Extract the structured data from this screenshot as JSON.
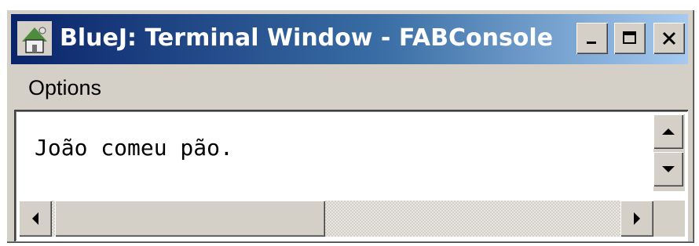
{
  "window": {
    "title": "BlueJ:  Terminal Window - FABConsole",
    "app_icon": "bluej-icon",
    "controls": {
      "minimize_icon": "minimize-icon",
      "maximize_icon": "maximize-icon",
      "close_icon": "close-icon"
    }
  },
  "menubar": {
    "items": [
      {
        "label": "Options"
      }
    ]
  },
  "terminal": {
    "output": "João comeu pão."
  },
  "colors": {
    "titlebar_start": "#0a246a",
    "titlebar_end": "#a6caf0",
    "window_face": "#d4d0c8",
    "terminal_bg": "#ffffff"
  }
}
